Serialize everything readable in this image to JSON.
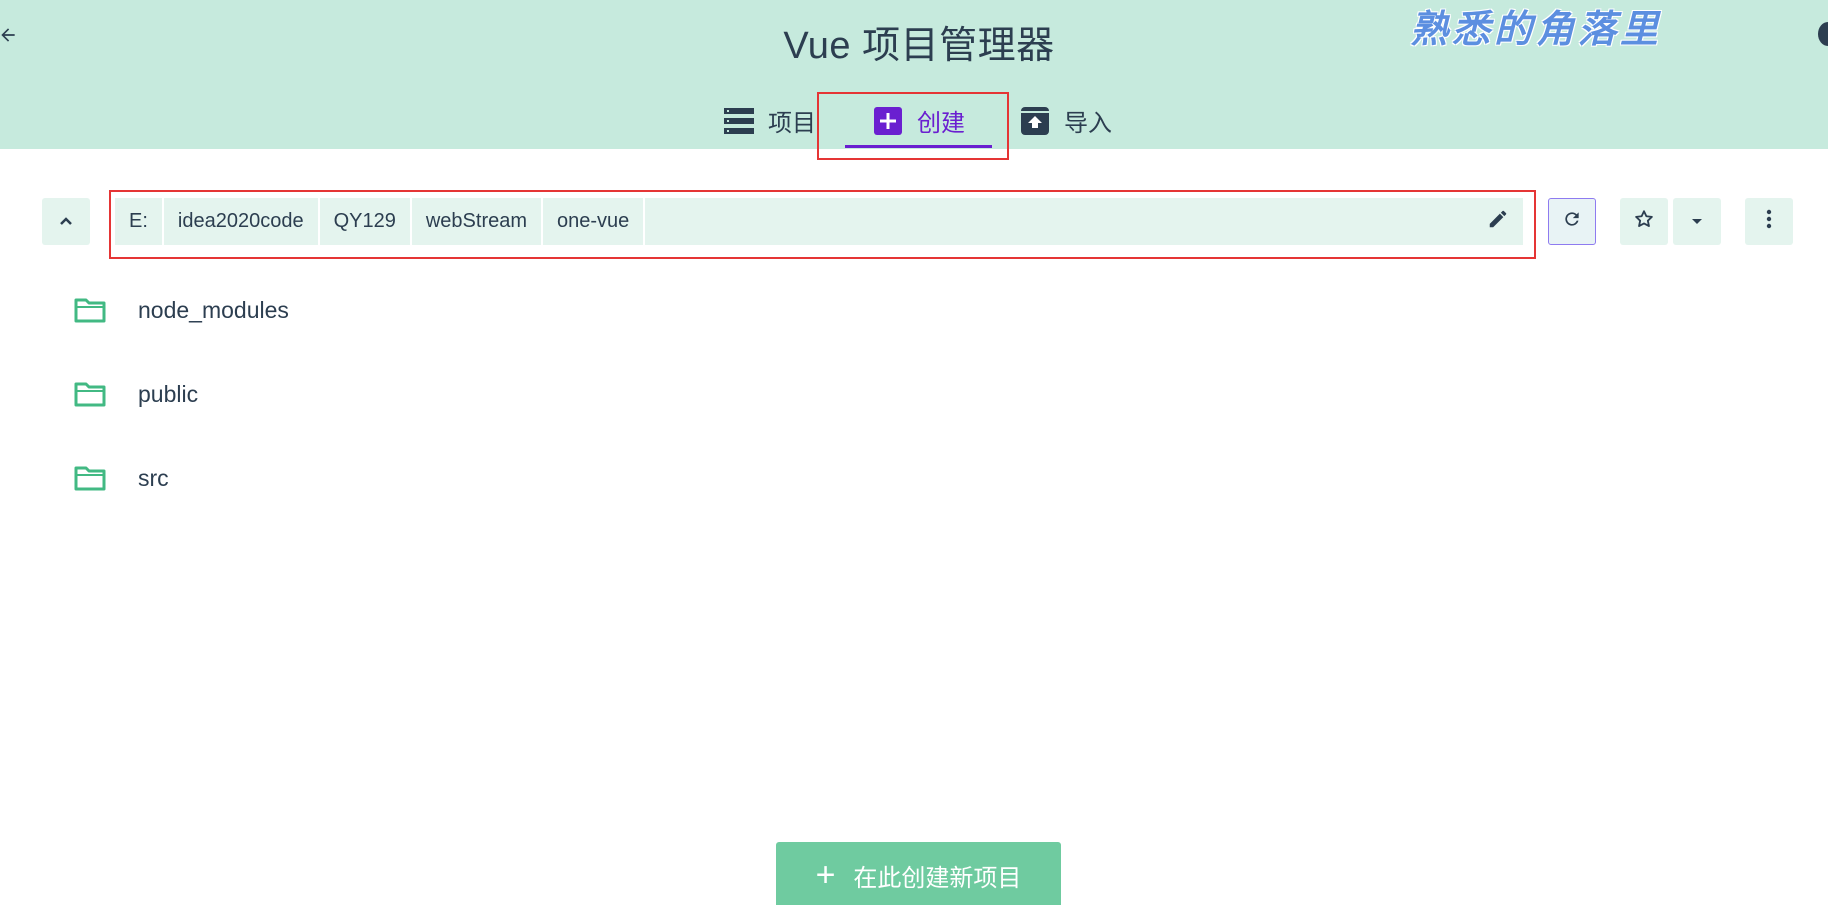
{
  "header": {
    "title": "Vue 项目管理器",
    "back_icon": "arrow-left-icon",
    "watermark": "熟悉的角落里",
    "tabs": [
      {
        "label": "项目",
        "icon": "list-icon",
        "active": false
      },
      {
        "label": "创建",
        "icon": "add-box-icon",
        "active": true
      },
      {
        "label": "导入",
        "icon": "unarchive-icon",
        "active": false
      }
    ]
  },
  "toolbar": {
    "up_icon": "chevron-up-icon",
    "path": [
      "E:",
      "idea2020code",
      "QY129",
      "webStream",
      "one-vue"
    ],
    "edit_icon": "pencil-icon",
    "refresh_icon": "refresh-icon",
    "favorite_icon": "star-icon",
    "dropdown_icon": "caret-down-icon",
    "more_icon": "more-vertical-icon"
  },
  "folders": [
    "node_modules",
    "public",
    "src"
  ],
  "create_button": {
    "label": "在此创建新项目",
    "icon": "plus-icon"
  },
  "colors": {
    "header_bg": "#c6eadd",
    "accent": "#6a1fd0",
    "folder_green": "#42b983",
    "primary_button": "#6fcba0",
    "highlight_red": "#e53535",
    "text": "#2c3e50"
  }
}
